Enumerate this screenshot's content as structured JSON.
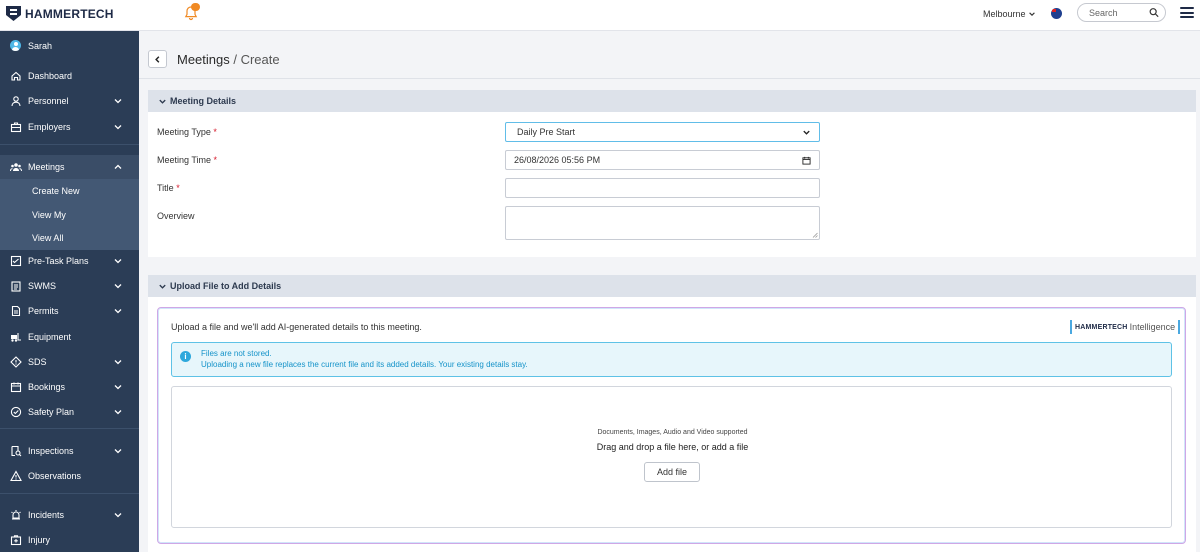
{
  "app": {
    "brand": "HAMMERTECH"
  },
  "topbar": {
    "location": "Melbourne",
    "search_placeholder": "Search"
  },
  "sidebar": {
    "user": "Sarah",
    "items": {
      "dashboard": "Dashboard",
      "personnel": "Personnel",
      "employers": "Employers",
      "meetings": "Meetings",
      "create_new": "Create New",
      "view_my": "View My",
      "view_all": "View All",
      "pretask": "Pre-Task Plans",
      "swms": "SWMS",
      "permits": "Permits",
      "equipment": "Equipment",
      "sds": "SDS",
      "bookings": "Bookings",
      "safety_plan": "Safety Plan",
      "inspections": "Inspections",
      "observations": "Observations",
      "incidents": "Incidents",
      "injury": "Injury"
    }
  },
  "header": {
    "title_main": "Meetings",
    "title_sep": " / ",
    "title_sub": "Create"
  },
  "meeting_details": {
    "heading": "Meeting Details",
    "type_label": "Meeting Type",
    "type_value": "Daily Pre Start",
    "time_label": "Meeting Time",
    "time_value": "26/08/2026 05:56 PM",
    "title_label": "Title",
    "title_value": "",
    "overview_label": "Overview",
    "required_mark": "*"
  },
  "upload": {
    "heading": "Upload File to Add Details",
    "intro": "Upload a file and we'll add AI-generated details to this meeting.",
    "brand_bold": "HAMMERTECH",
    "brand_light": "Intelligence",
    "info_line1": "Files are not stored.",
    "info_line2": "Uploading a new file replaces the current file and its added details. Your existing details stay.",
    "supported": "Documents, Images, Audio and Video supported",
    "drop_text": "Drag and drop a file here, or add a file",
    "add_button": "Add file"
  },
  "colors": {
    "sidebar_bg": "#2b3d56",
    "submenu_bg": "#435874",
    "accent_blue": "#2ea8dc",
    "required_red": "#d6182a",
    "badge_orange": "#f08a24"
  }
}
